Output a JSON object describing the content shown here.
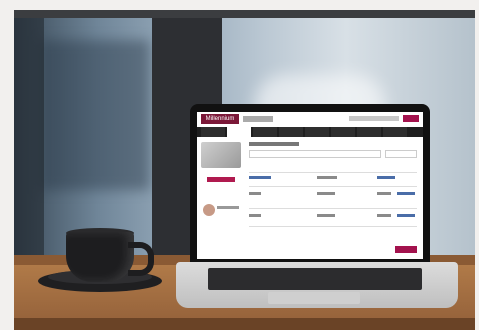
{
  "scene": {
    "objects": [
      "window",
      "coffee-cup",
      "saucer",
      "laptop",
      "wooden-table"
    ],
    "colors": {
      "accent": "#a3124d",
      "wood": "#94613a",
      "cup": "#1d1d1f"
    }
  },
  "laptop_screen": {
    "brand": "Millennium"
  }
}
